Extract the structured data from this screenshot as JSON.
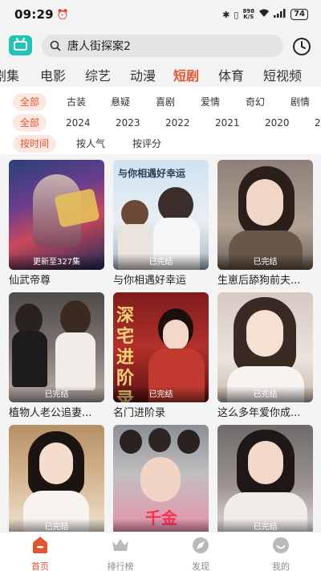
{
  "status": {
    "time": "09:29",
    "speed": "898\nK/S",
    "battery": "74"
  },
  "search": {
    "text": "唐人街探案2"
  },
  "channels": [
    "剧集",
    "电影",
    "综艺",
    "动漫",
    "短剧",
    "体育",
    "短视频"
  ],
  "channel_active": "短剧",
  "filters": {
    "genre": [
      "全部",
      "古装",
      "悬疑",
      "喜剧",
      "爱情",
      "奇幻",
      "剧情"
    ],
    "year": [
      "全部",
      "2024",
      "2023",
      "2022",
      "2021",
      "2020",
      "2"
    ],
    "sort": [
      "按时间",
      "按人气",
      "按评分"
    ]
  },
  "dramas": [
    {
      "title": "仙武帝尊",
      "badge": "更新至327集"
    },
    {
      "title": "与你相遇好幸运",
      "badge": "已完结",
      "poster_text": "与你相遇好幸运"
    },
    {
      "title": "生崽后舔狗前夫...",
      "badge": "已完结"
    },
    {
      "title": "植物人老公追妻...",
      "badge": "已完结"
    },
    {
      "title": "名门进阶录",
      "badge": "已完结",
      "poster_text": "深宅进阶录"
    },
    {
      "title": "这么多年爱你成...",
      "badge": "已完结"
    },
    {
      "title": "",
      "badge": "已完结"
    },
    {
      "title": "",
      "badge": "",
      "poster_text": "千金"
    },
    {
      "title": "",
      "badge": "已完结"
    }
  ],
  "nav": {
    "home": "首页",
    "rank": "排行榜",
    "discover": "发现",
    "mine": "我的"
  },
  "colors": {
    "accent": "#e5532f",
    "logo": "#1fc4b4"
  }
}
